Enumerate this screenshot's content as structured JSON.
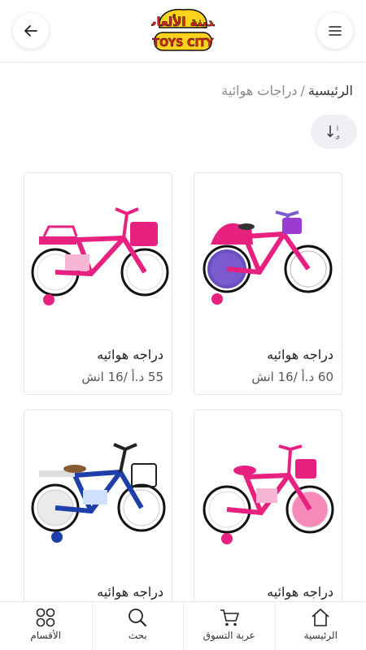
{
  "header": {
    "back_icon": "arrow-left-icon",
    "menu_icon": "hamburger-menu-icon",
    "logo_text_ar": "مدينة الألعاب",
    "logo_text_en": "TOYS CITY"
  },
  "breadcrumb": {
    "home": "الرئيسية",
    "separator": "/",
    "current": "دراجات هوائية"
  },
  "sort": {
    "icon": "sort-icon"
  },
  "products": [
    {
      "name": "دراجه هوائيه",
      "price": "60 د.أ /16 انش",
      "color": "#e6217f"
    },
    {
      "name": "دراجه هوائيه",
      "price": "55 د.أ /16 انش",
      "color": "#e6217f"
    },
    {
      "name": "دراجه هوائيه",
      "price": "",
      "color": "#e6217f"
    },
    {
      "name": "دراجه هوائيه",
      "price": "",
      "color": "#1f3fa8"
    }
  ],
  "bottom_nav": {
    "home": "الرئيسية",
    "cart": "عربة التسوق",
    "search": "بحث",
    "categories": "الأقسام"
  },
  "colors": {
    "accent_pink": "#e6217f",
    "accent_blue": "#1f3fa8",
    "logo_red": "#e0241b",
    "logo_yellow": "#ffd21f"
  }
}
